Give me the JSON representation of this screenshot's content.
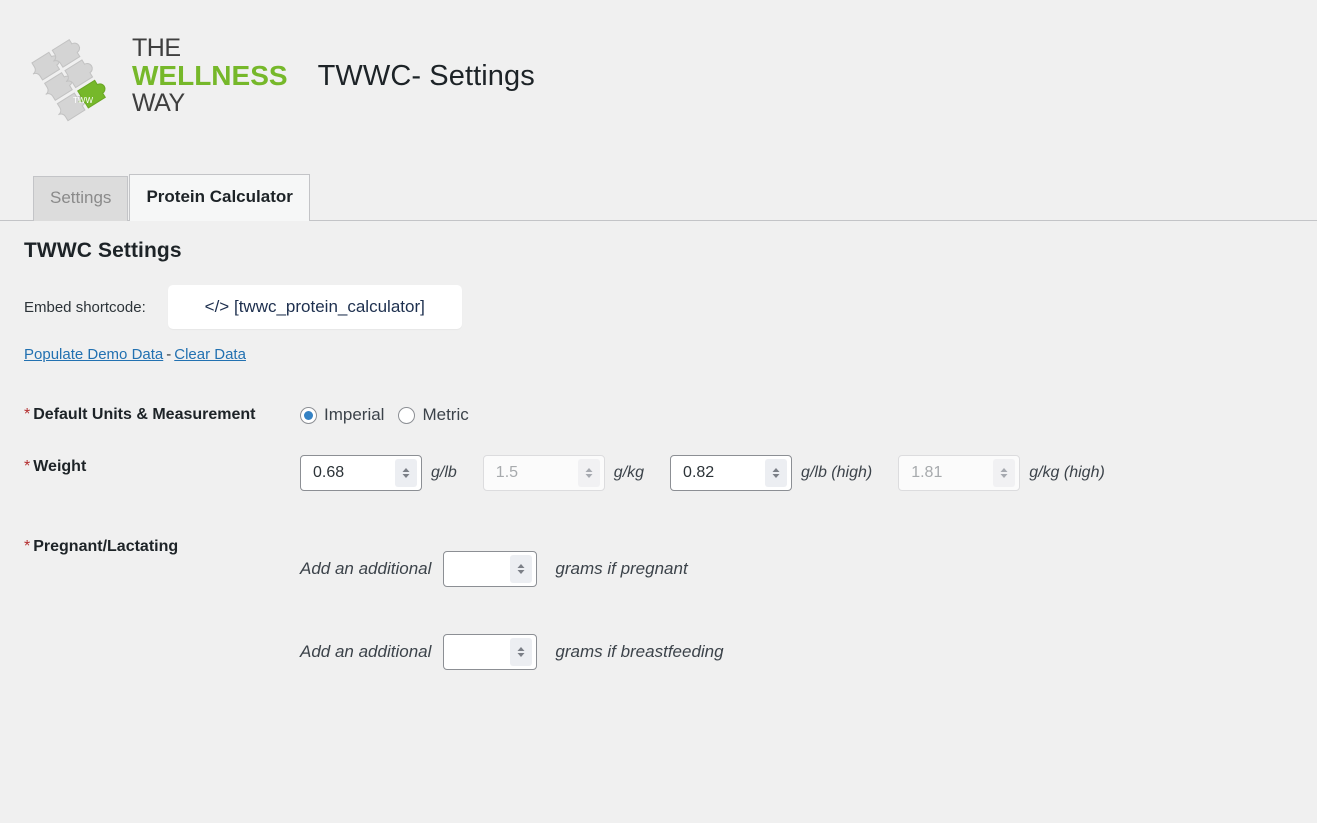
{
  "header": {
    "logo": {
      "line1": "THE",
      "line2": "WELLNESS",
      "line3": "WAY",
      "badge": "TWW",
      "green": "#76b82a",
      "gray": "#d0d0d0"
    },
    "title": "TWWC- Settings"
  },
  "tabs": [
    {
      "label": "Settings",
      "active": false
    },
    {
      "label": "Protein Calculator",
      "active": true
    }
  ],
  "main": {
    "section_title": "TWWC Settings",
    "shortcode": {
      "label": "Embed shortcode:",
      "icon": "code-icon",
      "icon_glyph": "</>",
      "value": "[twwc_protein_calculator]"
    },
    "data_links": {
      "populate": "Populate Demo Data",
      "separator": "-",
      "clear": "Clear Data"
    },
    "fields": {
      "units": {
        "required_mark": "*",
        "label": "Default Units & Measurement",
        "options": [
          {
            "label": "Imperial",
            "selected": true
          },
          {
            "label": "Metric",
            "selected": false
          }
        ],
        "accent": "#3582c4"
      },
      "weight": {
        "required_mark": "*",
        "label": "Weight",
        "inputs": [
          {
            "value": "0.68",
            "unit": "g/lb",
            "disabled": false
          },
          {
            "value": "1.5",
            "unit": "g/kg",
            "disabled": true
          },
          {
            "value": "0.82",
            "unit": "g/lb (high)",
            "disabled": false
          },
          {
            "value": "1.81",
            "unit": "g/kg (high)",
            "disabled": true
          }
        ]
      },
      "pregnancy": {
        "required_mark": "*",
        "label": "Pregnant/Lactating",
        "rows": [
          {
            "prefix": "Add an additional",
            "value": "",
            "suffix": "grams if pregnant"
          },
          {
            "prefix": "Add an additional",
            "value": "",
            "suffix": "grams if breastfeeding"
          }
        ]
      }
    }
  }
}
